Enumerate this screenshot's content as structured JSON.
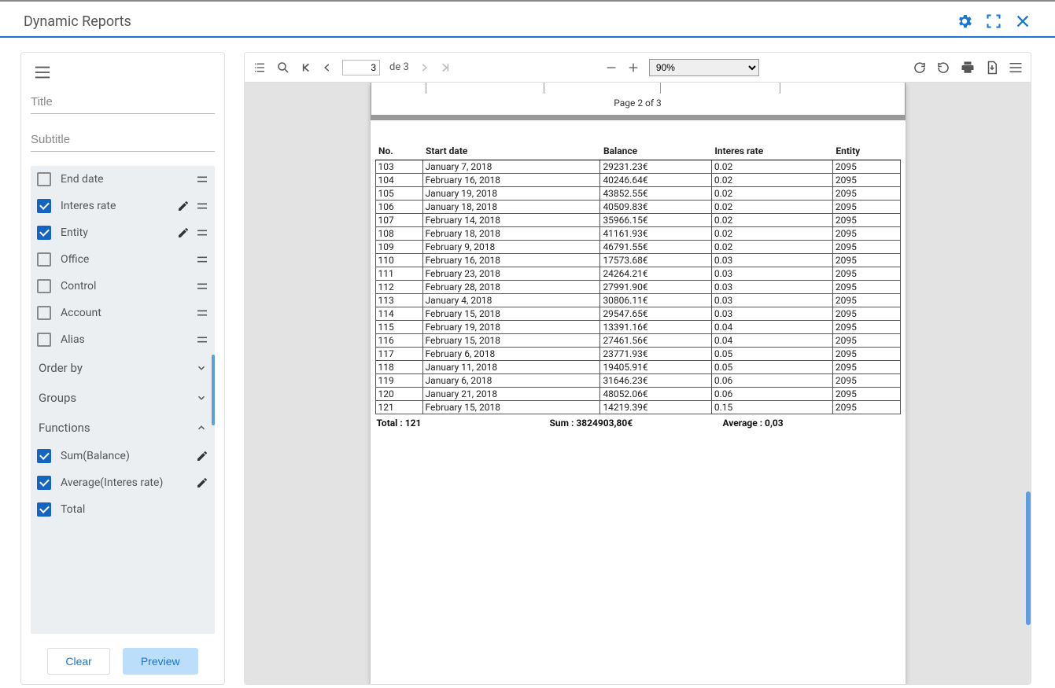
{
  "header": {
    "title": "Dynamic Reports"
  },
  "sidebar": {
    "title_placeholder": "Title",
    "subtitle_placeholder": "Subtitle",
    "columns": [
      {
        "label": "End date",
        "checked": false,
        "edit": false
      },
      {
        "label": "Interes rate",
        "checked": true,
        "edit": true
      },
      {
        "label": "Entity",
        "checked": true,
        "edit": true
      },
      {
        "label": "Office",
        "checked": false,
        "edit": false
      },
      {
        "label": "Control",
        "checked": false,
        "edit": false
      },
      {
        "label": "Account",
        "checked": false,
        "edit": false
      },
      {
        "label": "Alias",
        "checked": false,
        "edit": false
      }
    ],
    "sections": {
      "orderby": "Order by",
      "groups": "Groups",
      "functions": "Functions"
    },
    "functions": [
      {
        "label": "Sum(Balance)",
        "checked": true,
        "edit": true
      },
      {
        "label": "Average(Interes rate)",
        "checked": true,
        "edit": true
      },
      {
        "label": "Total",
        "checked": true,
        "edit": false
      }
    ],
    "buttons": {
      "clear": "Clear",
      "preview": "Preview"
    }
  },
  "toolbar": {
    "page_input": "3",
    "page_of": "de 3",
    "zoom": "90%"
  },
  "report": {
    "page_label": "Page 2 of 3",
    "headers": [
      "No.",
      "Start date",
      "Balance",
      "Interes rate",
      "Entity"
    ],
    "rows": [
      [
        "103",
        "January 7, 2018",
        "29231.23€",
        "0.02",
        "2095"
      ],
      [
        "104",
        "February 16, 2018",
        "40246.64€",
        "0.02",
        "2095"
      ],
      [
        "105",
        "January 19, 2018",
        "43852.55€",
        "0.02",
        "2095"
      ],
      [
        "106",
        "January 18, 2018",
        "40509.83€",
        "0.02",
        "2095"
      ],
      [
        "107",
        "February 14, 2018",
        "35966.15€",
        "0.02",
        "2095"
      ],
      [
        "108",
        "February 18, 2018",
        "41161.93€",
        "0.02",
        "2095"
      ],
      [
        "109",
        "February 9, 2018",
        "46791.55€",
        "0.02",
        "2095"
      ],
      [
        "110",
        "February 16, 2018",
        "17573.68€",
        "0.03",
        "2095"
      ],
      [
        "111",
        "February 23, 2018",
        "24264.21€",
        "0.03",
        "2095"
      ],
      [
        "112",
        "February 28, 2018",
        "27991.90€",
        "0.03",
        "2095"
      ],
      [
        "113",
        "January 4, 2018",
        "30806.11€",
        "0.03",
        "2095"
      ],
      [
        "114",
        "February 15, 2018",
        "29547.65€",
        "0.03",
        "2095"
      ],
      [
        "115",
        "February 19, 2018",
        "13391.16€",
        "0.04",
        "2095"
      ],
      [
        "116",
        "February 15, 2018",
        "27461.56€",
        "0.04",
        "2095"
      ],
      [
        "117",
        "February 6, 2018",
        "23771.93€",
        "0.05",
        "2095"
      ],
      [
        "118",
        "January 11, 2018",
        "19405.91€",
        "0.05",
        "2095"
      ],
      [
        "119",
        "January 6, 2018",
        "31646.23€",
        "0.06",
        "2095"
      ],
      [
        "120",
        "January 21, 2018",
        "48052.06€",
        "0.06",
        "2095"
      ],
      [
        "121",
        "February 15, 2018",
        "14219.39€",
        "0.15",
        "2095"
      ]
    ],
    "summary": {
      "total": "Total : 121",
      "sum": "Sum : 3824903,80€",
      "avg": "Average : 0,03"
    }
  }
}
